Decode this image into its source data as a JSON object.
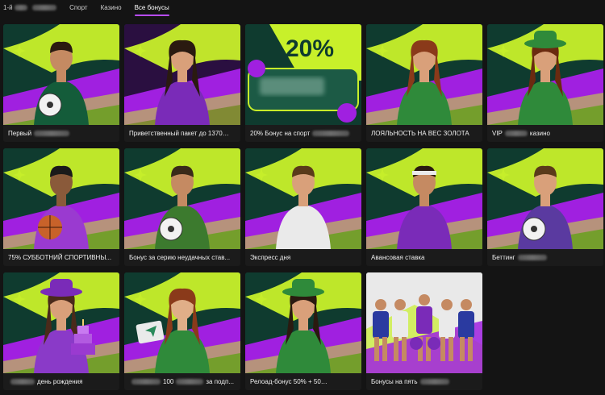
{
  "tabs": {
    "first_prefix": "1-й",
    "sport": "Спорт",
    "casino": "Казино",
    "all_bonuses": "Все бонусы"
  },
  "colors": {
    "accent": "#b94cff",
    "lime": "#c8f02a",
    "purple": "#a020e0",
    "teal_bg": "#0f3b2f"
  },
  "cards": [
    {
      "caption_pre": "Первый",
      "caption_post": "",
      "icon": "footballer-with-ball-illustration"
    },
    {
      "caption_pre": "Приветственный пакет до 1370",
      "caption_post": "",
      "icon": "woman-in-purple-illustration"
    },
    {
      "caption_pre": "20% Бонус на спорт",
      "caption_post": "",
      "icon": "percent-promo-illustration",
      "promo": "20%"
    },
    {
      "caption_pre": "ЛОЯЛЬНОСТЬ НА ВЕС ЗОЛОТА",
      "caption_post": "",
      "icon": "woman-in-gold-illustration"
    },
    {
      "caption_pre": "VIP",
      "caption_post": "казино",
      "icon": "woman-in-green-hat-illustration"
    },
    {
      "caption_pre": "75% СУББОТНИЙ СПОРТИВНЫ...",
      "caption_post": "",
      "icon": "basketball-player-illustration"
    },
    {
      "caption_pre": "Бонус за серию неудачных став...",
      "caption_post": "",
      "icon": "man-in-green-jacket-illustration"
    },
    {
      "caption_pre": "Экспресс дня",
      "caption_post": "",
      "icon": "footballer-green-kit-illustration"
    },
    {
      "caption_pre": "Авансовая ставка",
      "caption_post": "",
      "icon": "tennis-player-illustration"
    },
    {
      "caption_pre": "Беттинг",
      "caption_post": "",
      "icon": "footballer-purple-kit-illustration"
    },
    {
      "caption_pre": "",
      "caption_post": "день рождения",
      "icon": "birthday-cake-woman-illustration"
    },
    {
      "caption_pre": "",
      "caption_post": "100",
      "caption_tail": "за подп...",
      "icon": "telegram-woman-illustration"
    },
    {
      "caption_pre": "Релоад-бонус 50% + 50",
      "caption_post": "",
      "icon": "woman-with-cards-illustration"
    },
    {
      "caption_pre": "Бонусы на пять",
      "caption_post": "",
      "icon": "five-athletes-illustration"
    }
  ]
}
